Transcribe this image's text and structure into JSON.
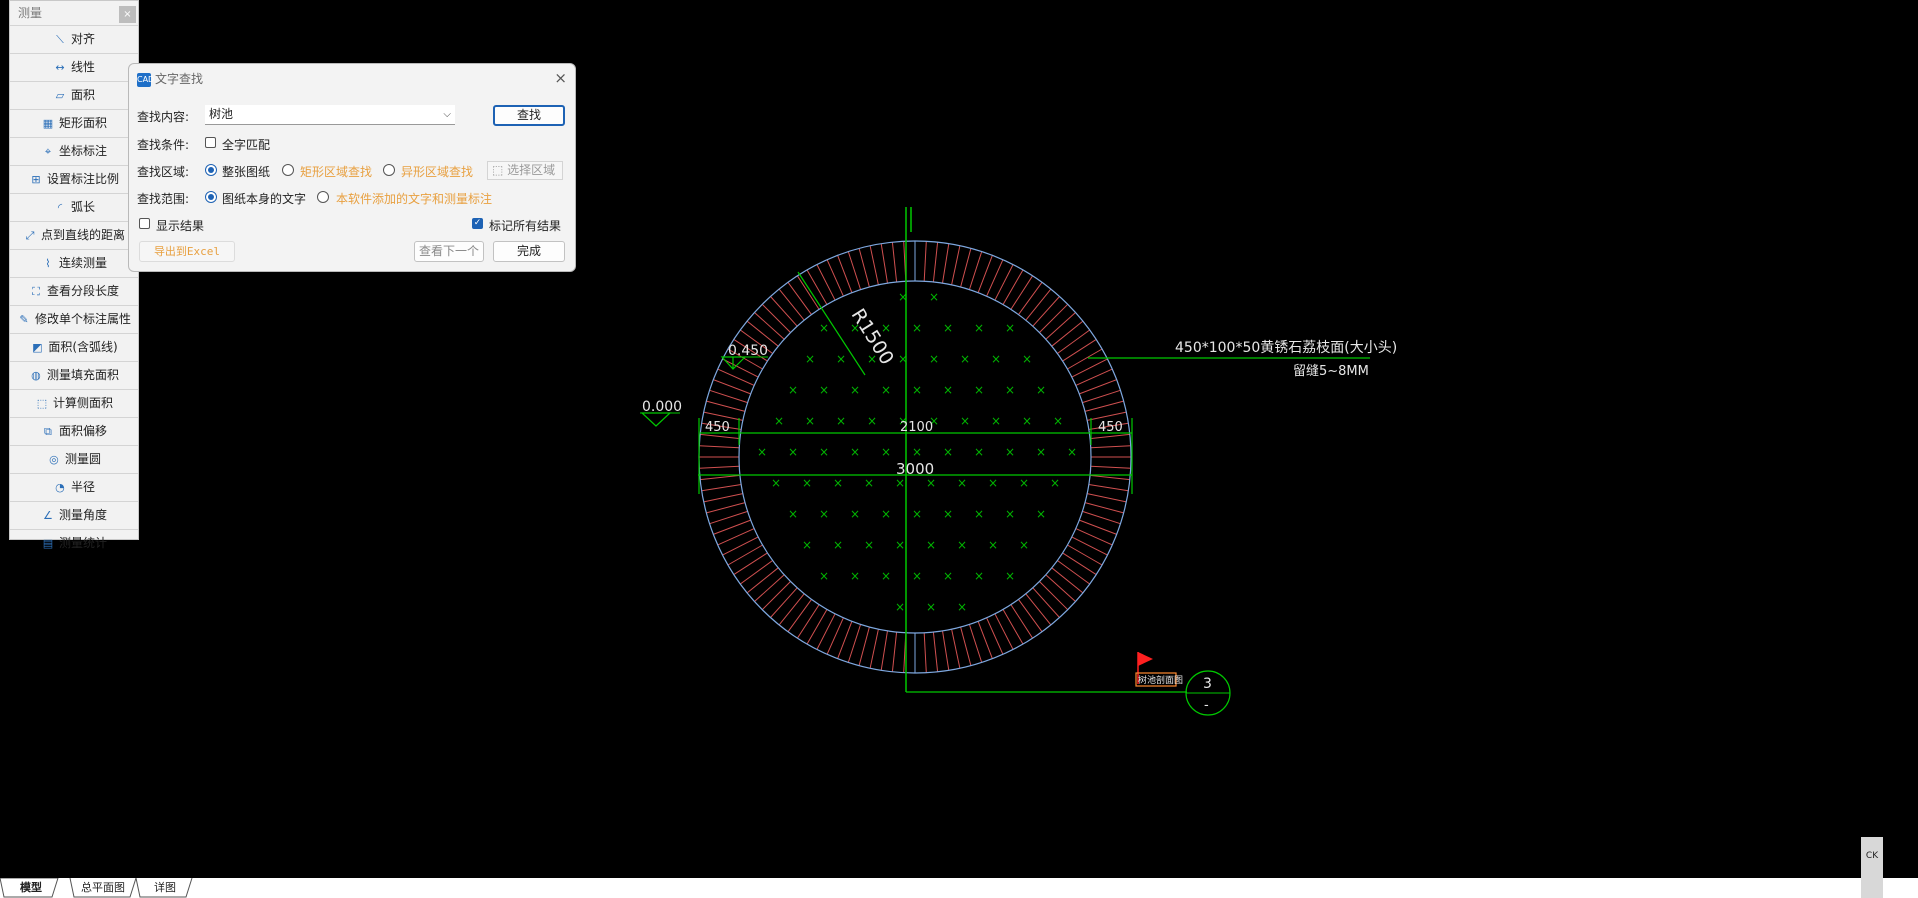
{
  "measure_panel": {
    "title": "测量",
    "close": "×",
    "items": [
      {
        "label": "对齐",
        "icon": "align-measure-icon",
        "glyph": "⟍"
      },
      {
        "label": "线性",
        "icon": "linear-measure-icon",
        "glyph": "↔"
      },
      {
        "label": "面积",
        "icon": "area-icon",
        "glyph": "▱"
      },
      {
        "label": "矩形面积",
        "icon": "rect-area-icon",
        "glyph": "▦"
      },
      {
        "label": "坐标标注",
        "icon": "coordinate-icon",
        "glyph": "⌖"
      },
      {
        "label": "设置标注比例",
        "icon": "scale-icon",
        "glyph": "⊞"
      },
      {
        "label": "弧长",
        "icon": "arc-length-icon",
        "glyph": "◜"
      },
      {
        "label": "点到直线的距离",
        "icon": "point-line-distance-icon",
        "glyph": "⤢"
      },
      {
        "label": "连续测量",
        "icon": "continuous-measure-icon",
        "glyph": "⌇"
      },
      {
        "label": "查看分段长度",
        "icon": "segment-length-icon",
        "glyph": "⛶"
      },
      {
        "label": "修改单个标注属性",
        "icon": "edit-annotation-icon",
        "glyph": "✎"
      },
      {
        "label": "面积(含弧线)",
        "icon": "arc-area-icon",
        "glyph": "◩"
      },
      {
        "label": "测量填充面积",
        "icon": "fill-area-icon",
        "glyph": "◍"
      },
      {
        "label": "计算侧面积",
        "icon": "side-area-icon",
        "glyph": "⬚"
      },
      {
        "label": "面积偏移",
        "icon": "area-offset-icon",
        "glyph": "⧉"
      },
      {
        "label": "测量圆",
        "icon": "circle-measure-icon",
        "glyph": "◎"
      },
      {
        "label": "半径",
        "icon": "radius-icon",
        "glyph": "◔"
      },
      {
        "label": "测量角度",
        "icon": "angle-icon",
        "glyph": "∠"
      },
      {
        "label": "测量统计",
        "icon": "statistics-icon",
        "glyph": "▤"
      }
    ]
  },
  "dialog": {
    "app_icon_text": "CAD",
    "title": "文字查找",
    "close": "×",
    "content_label": "查找内容:",
    "content_value": "树池",
    "find_button": "查找",
    "condition_label": "查找条件:",
    "full_match": "全字匹配",
    "area_label": "查找区域:",
    "area_options": [
      "整张图纸",
      "矩形区域查找",
      "异形区域查找"
    ],
    "select_area_button": "选择区域",
    "scope_label": "查找范围:",
    "scope_options": [
      "图纸本身的文字",
      "本软件添加的文字和测量标注"
    ],
    "show_results": "显示结果",
    "mark_all": "标记所有结果",
    "export_button": "导出到Excel",
    "next_button": "查看下一个",
    "done_button": "完成"
  },
  "drawing": {
    "radius_label": "R1500",
    "level_top": "0.450",
    "level_left": "0.000",
    "dim_left": "450",
    "dim_right": "450",
    "dim_inner": "2100",
    "dim_outer": "3000",
    "leader_line1": "450*100*50黄锈石荔枝面(大小头)",
    "leader_line2": "留缝5~8MM",
    "marker_text": "树池剖面图",
    "detail_number": "3",
    "detail_sub": "-"
  },
  "tabs": [
    "模型",
    "总平面图",
    "详图"
  ],
  "corner_text": "CK",
  "colors": {
    "accent": "#1d62b4",
    "cad_green": "#00c800",
    "cad_red": "#d05050",
    "cad_blue": "#7ea8e0",
    "cad_white": "#e6e6e6",
    "orange_text": "#e8a040",
    "flag": "#ff2020"
  }
}
